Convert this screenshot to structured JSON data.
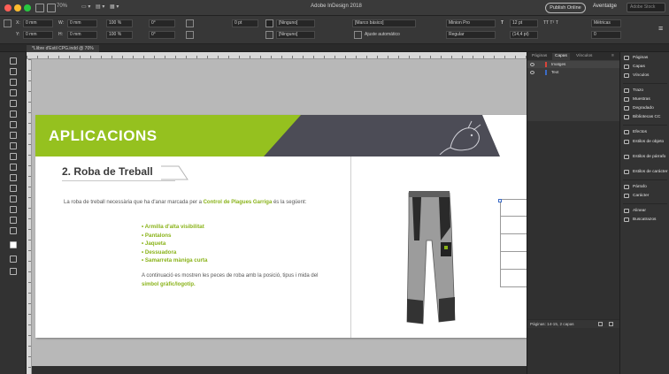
{
  "window": {
    "title": "Adobe InDesign 2018",
    "zoom": "70%",
    "publish_label": "Publish Online",
    "workspace_label": "Aventatge",
    "search_placeholder": "Adobe Stock"
  },
  "control_bar": {
    "x": "0 mm",
    "y": "0 mm",
    "w": "0 mm",
    "h": "0 mm",
    "scale_pct": "100 %",
    "angle": "0°",
    "shear": "0°",
    "stroke_weight": "0 pt",
    "fill_color": "[Ninguno]",
    "stroke_color": "[Ninguno]",
    "style_label": "[Marco básico]",
    "font": "Minion Pro",
    "font_style": "Regular",
    "font_size": "12 pt",
    "leading": "(14,4 pt)",
    "metrics": "Métricas",
    "tracking": "0",
    "opacity": "100 %",
    "auto_fit": "Ajuste automático"
  },
  "document": {
    "tab_label": "*Llibre d'Estil CPG.indd @ 70%",
    "banner_title": "APLICACIONS",
    "section_title": "2. Roba de Treball",
    "intro_part1": "La roba de treball necessària que ha d'anar marcada per a",
    "intro_highlight": "Control de Plagues Garriga",
    "intro_part2": "és la següent:",
    "bullets": [
      "Armilla d'alta visibilitat",
      "Pantalons",
      "Jaqueta",
      "Dessuadora",
      "Samarreta màniga curta"
    ],
    "closing_part1": "A continuació es mostren les peces de roba amb la posició, tipus i mida del",
    "closing_highlight": "símbol gràfic/logotip.",
    "colors": {
      "green": "#95c11f",
      "dark": "#4c4c56",
      "highlight": "#8ab31a"
    }
  },
  "layers_panel": {
    "tabs": [
      "Páginas",
      "Capas",
      "Vínculos"
    ],
    "active_tab": "Capas",
    "layers": [
      {
        "name": "Imatges",
        "color": "#d9443a"
      },
      {
        "name": "Text",
        "color": "#3b6bc7"
      }
    ],
    "footer_text": "Páginas: 14-15, 2 capas"
  },
  "dock_panels": [
    {
      "label": "Páginas",
      "icon": "pages-icon"
    },
    {
      "label": "Capas",
      "icon": "layers-icon"
    },
    {
      "label": "Vínculos",
      "icon": "links-icon"
    },
    {
      "label": "Trazo",
      "icon": "stroke-icon"
    },
    {
      "label": "Muestras",
      "icon": "swatches-icon"
    },
    {
      "label": "Degradado",
      "icon": "gradient-icon"
    },
    {
      "label": "Bibliotecas CC",
      "icon": "cc-libraries-icon"
    },
    {
      "label": "Efectos",
      "icon": "effects-icon"
    },
    {
      "label": "Estilos de objeto",
      "icon": "object-styles-icon"
    },
    {
      "label": "Estilos de párrafo",
      "icon": "paragraph-styles-icon"
    },
    {
      "label": "Estilos de carácter",
      "icon": "character-styles-icon"
    },
    {
      "label": "Párrafo",
      "icon": "paragraph-icon"
    },
    {
      "label": "Carácter",
      "icon": "character-icon"
    },
    {
      "label": "Alinear",
      "icon": "align-icon"
    },
    {
      "label": "Buscatrazos",
      "icon": "pathfinder-icon"
    }
  ]
}
